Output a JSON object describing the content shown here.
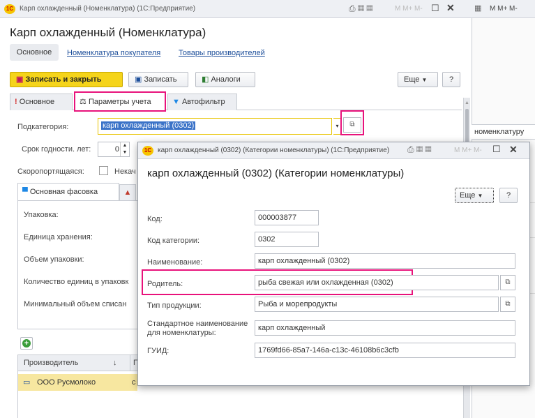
{
  "app": {
    "window_title": "Карп охлажденный (Номенклатура) (1С:Предприятие)",
    "logo": "1С"
  },
  "form": {
    "title": "Карп охлажденный (Номенклатура)",
    "nav": {
      "main": "Основное",
      "link1": "Номенклатура покупателя",
      "link2": "Товары производителей"
    },
    "toolbar": {
      "save_close": "Записать и закрыть",
      "save": "Записать",
      "analogs": "Аналоги",
      "more": "Еще",
      "help": "?"
    },
    "tabs": {
      "main": "Основное",
      "params": "Параметры учета",
      "autofilter": "Автофильтр"
    },
    "subcategory_label": "Подкатегория:",
    "subcategory_value": "карп охлажденный (0302)",
    "shelf_life_label": "Срок годности. лет:",
    "shelf_life_value": "0",
    "perishable_label": "Скоропортящаяся:",
    "perishable_text": "Некач",
    "packaging_tab": "Основная фасовка",
    "packaging_fields": {
      "pack": "Упаковка:",
      "unit": "Единица хранения:",
      "volume": "Объем упаковки:",
      "count": "Количество единиц в упаковк",
      "minvol": "Минимальный объем списан"
    },
    "table": {
      "col_producer": "Производитель",
      "sort_arrow": "↓",
      "col2": "П",
      "row1_producer": "ООО Русмолоко",
      "row1_col2": "с"
    }
  },
  "right_panel": {
    "toolbar_text": "M  M+  M-",
    "snippet": "номенклатуру"
  },
  "dialog": {
    "window_title": "карп охлажденный (0302) (Категории номенклатуры) (1С:Предприятие)",
    "title": "карп охлажденный (0302) (Категории номенклатуры)",
    "more": "Еще",
    "help": "?",
    "fields": {
      "code_label": "Код:",
      "code_value": "000003877",
      "catcode_label": "Код категории:",
      "catcode_value": "0302",
      "name_label": "Наименование:",
      "name_value": "карп охлажденный (0302)",
      "parent_label": "Родитель:",
      "parent_value": "рыба свежая или охлажденная (0302)",
      "type_label": "Тип продукции:",
      "type_value": "Рыба и морепродукты",
      "std_label_1": "Стандартное наименование",
      "std_label_2": "для номенклатуры:",
      "std_value": "карп охлажденный",
      "guid_label": "ГУИД:",
      "guid_value": "1769fd66-85a7-146a-c13c-46108b6c3cfb"
    },
    "toolbar_text": "M  M+  M-"
  },
  "colors": {
    "highlight": "#e8127b",
    "yellow_button": "#f5d41a",
    "link": "#1c4e9a"
  }
}
